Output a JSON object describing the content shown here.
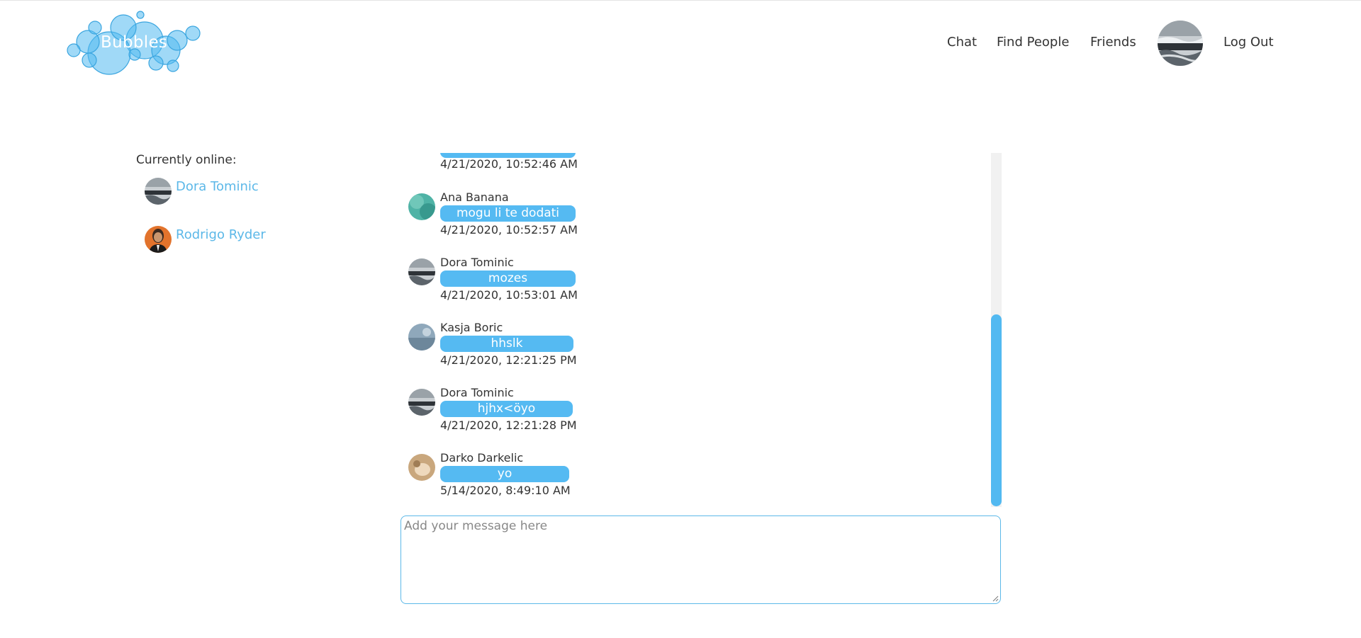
{
  "brand": {
    "name": "Bubbles",
    "bubble_color": "#52b9f1"
  },
  "nav": {
    "items": [
      {
        "label": "Chat"
      },
      {
        "label": "Find People"
      },
      {
        "label": "Friends"
      },
      {
        "label": "Log Out"
      }
    ],
    "highlight_color": "#c5e7fa"
  },
  "online": {
    "title": "Currently online:",
    "users": [
      {
        "name": "Dora Tominic",
        "avatar": "stormy-sea-avatar"
      },
      {
        "name": "Rodrigo Ryder",
        "avatar": "man-portrait-avatar"
      }
    ]
  },
  "chat": {
    "top_partial": {
      "timestamp": "4/21/2020, 10:52:46 AM"
    },
    "messages": [
      {
        "author": "Ana Banana",
        "text": "mogu li te dodati",
        "timestamp": "4/21/2020, 10:52:57 AM",
        "avatar": "green-water-avatar"
      },
      {
        "author": "Dora Tominic",
        "text": "mozes",
        "timestamp": "4/21/2020, 10:53:01 AM",
        "avatar": "stormy-sea-avatar"
      },
      {
        "author": "Kasja Boric",
        "text": "hhslk",
        "timestamp": "4/21/2020, 12:21:25 PM",
        "avatar": "blue-sky-avatar"
      },
      {
        "author": "Dora Tominic",
        "text": "hjhx<öyo",
        "timestamp": "4/21/2020, 12:21:28 PM",
        "avatar": "stormy-sea-avatar"
      },
      {
        "author": "Darko Darkelic",
        "text": "yo",
        "timestamp": "5/14/2020, 8:49:10 AM",
        "avatar": "beige-animal-avatar"
      }
    ],
    "bubble_color": "#55baf2",
    "composer_placeholder": "Add your message here"
  }
}
